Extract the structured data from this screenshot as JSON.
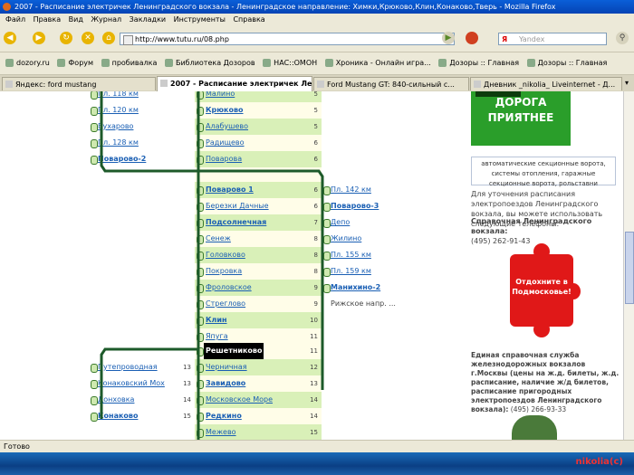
{
  "window": {
    "title": "2007 - Расписание электричек Ленинградского вокзала - Ленинградское направление: Химки,Крюково,Клин,Конаково,Тверь - Mozilla Firefox"
  },
  "menu": [
    "Файл",
    "Правка",
    "Вид",
    "Журнал",
    "Закладки",
    "Инструменты",
    "Справка"
  ],
  "nav": {
    "url": "http://www.tutu.ru/08.php",
    "search_placeholder": "Yandex"
  },
  "bookmarks": [
    "dozory.ru",
    "Форум",
    "пробивалка",
    "Библиотека Дозоров",
    "НАС::ОМОН",
    "Хроника - Онлайн игра...",
    "Дозоры :: Главная",
    "Дозоры :: Главная"
  ],
  "tabs": [
    "Яндекс: ford mustang",
    "2007 - Расписание электричек Ле...",
    "Ford Mustang GT: 840-сильный с...",
    "Дневник _nikolia_ Liveinternet - Д..."
  ],
  "left_branch": [
    {
      "name": "Пл. 118 км",
      "zone": ""
    },
    {
      "name": "Пл. 120 км",
      "zone": ""
    },
    {
      "name": "Бухарово",
      "zone": ""
    },
    {
      "name": "Пл. 128 км",
      "zone": ""
    },
    {
      "name": "Поварово-2",
      "zone": ""
    }
  ],
  "left_branch2": [
    {
      "name": "Путепроводная",
      "zone": "13"
    },
    {
      "name": "Конаковский Мох",
      "zone": "13"
    },
    {
      "name": "Донховка",
      "zone": "14"
    },
    {
      "name": "Конаково",
      "zone": "15"
    }
  ],
  "main_line": [
    {
      "name": "Малино",
      "zone": "5"
    },
    {
      "name": "Крюково",
      "zone": "5"
    },
    {
      "name": "Алабушево",
      "zone": "5"
    },
    {
      "name": "Радищево",
      "zone": "6"
    },
    {
      "name": "Поварова",
      "zone": "6"
    },
    {
      "name": "Поварово 1",
      "zone": "6"
    },
    {
      "name": "Березки Дачные",
      "zone": "6"
    },
    {
      "name": "Подсолнечная",
      "zone": "7"
    },
    {
      "name": "Сенеж",
      "zone": "8"
    },
    {
      "name": "Головково",
      "zone": "8"
    },
    {
      "name": "Покровка",
      "zone": "8"
    },
    {
      "name": "Фроловское",
      "zone": "9"
    },
    {
      "name": "Стреглово",
      "zone": "9"
    },
    {
      "name": "Клин",
      "zone": "10"
    },
    {
      "name": "Япуга",
      "zone": "11"
    },
    {
      "name": "Решетниково",
      "zone": "11"
    },
    {
      "name": "Черничная",
      "zone": "12"
    },
    {
      "name": "Завидово",
      "zone": "13"
    },
    {
      "name": "Московское Море",
      "zone": "14"
    },
    {
      "name": "Редкино",
      "zone": "14"
    },
    {
      "name": "Межево",
      "zone": "15"
    }
  ],
  "right_branch": [
    {
      "name": "Пл. 142 км"
    },
    {
      "name": "Поварово-3"
    },
    {
      "name": "Депо"
    },
    {
      "name": "Жилино"
    },
    {
      "name": "Пл. 155 км"
    },
    {
      "name": "Пл. 159 км"
    },
    {
      "name": "Манихино-2"
    },
    {
      "name": "Рижское напр. ..."
    }
  ],
  "sidebar": {
    "ad1_text": "ДОРОГА ПРИЯТНЕЕ",
    "ad_caption": "автоматические секционные ворота, системы отопления, гаражные секционные ворота, рольставни",
    "info1": "Для уточнения расписания электропоездов Ленинградского вокзала, вы можете использовать следующие телефоны:",
    "phone_label": "Справочная Ленинградского вокзала:",
    "phone1": "(495) 262-91-43",
    "ad2_text": "Отдохните в Подмосковье!",
    "info2_bold": "Единая справочная служба железнодорожных вокзалов г.Москвы (цены на ж.д. билеты, ж.д. расписание, наличие ж/д билетов, расписание пригородных электропоездов Ленинградского вокзала):",
    "phone2": "(495) 266-93-33"
  },
  "status": "Готово",
  "watermark": "nikolia(c)",
  "colors": {
    "route_line": "#1d5a2a",
    "highlight": "#d9f0b8",
    "link": "#1a5fb4"
  }
}
